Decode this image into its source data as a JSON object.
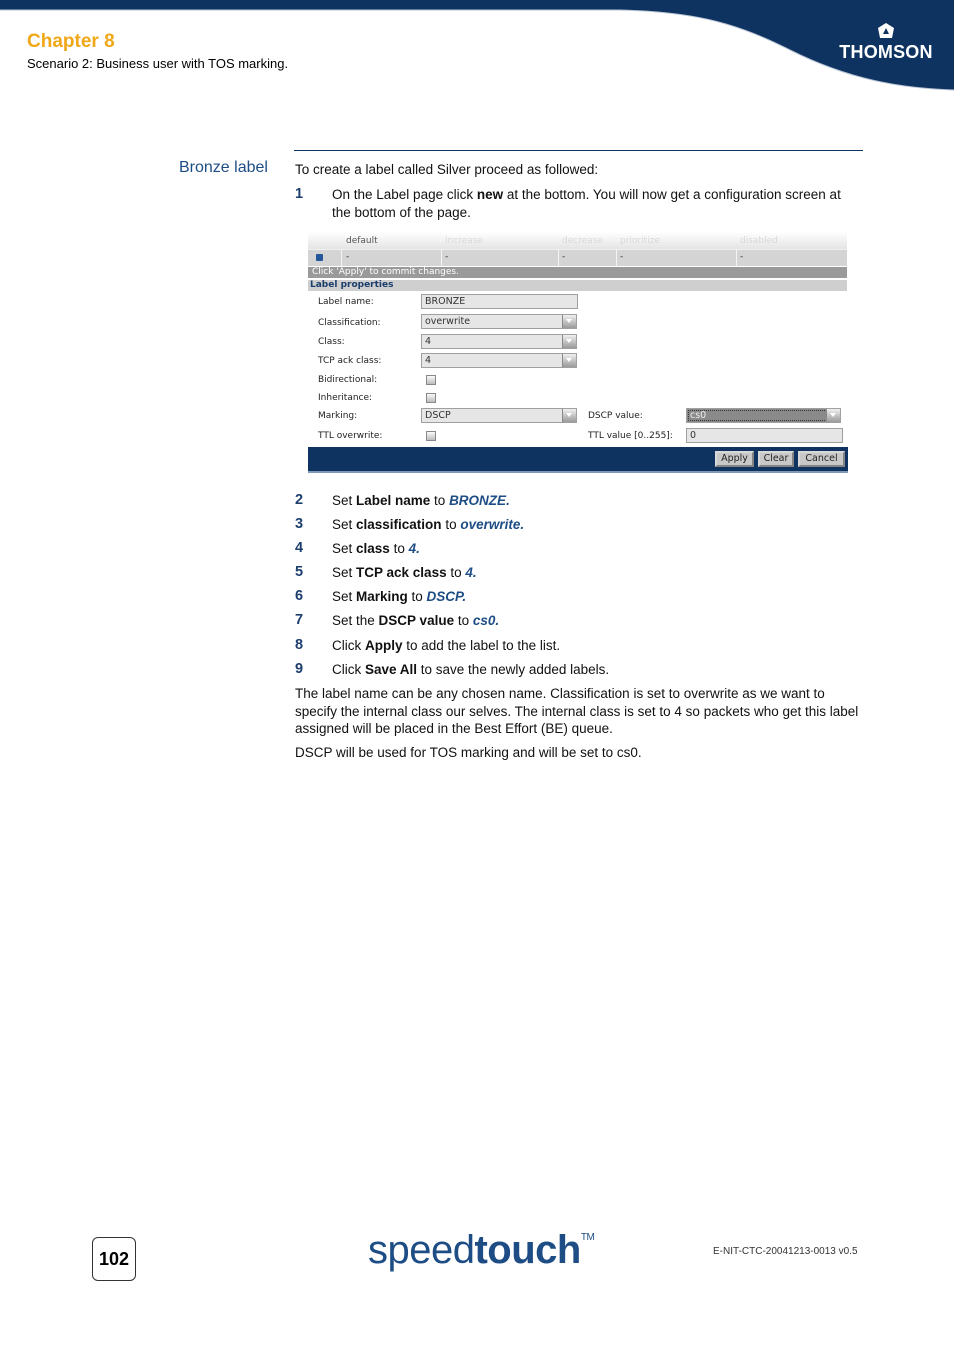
{
  "header": {
    "chapter": "Chapter 8",
    "subtitle": "Scenario 2: Business user with TOS marking.",
    "brand": "THOMSON",
    "brand_icon": "thomson-triangle-icon",
    "colors": {
      "band": "#0e3360",
      "chapter": "#f0a818",
      "accent": "#1d4d84"
    }
  },
  "section": {
    "heading": "Bronze label",
    "intro": "To create a label called Silver proceed as followed:"
  },
  "step1": {
    "num": "1",
    "pre": "On the Label page click ",
    "bold": "new",
    "post": " at the bottom. You will now get a configuration screen at the bottom of the page."
  },
  "screenshot": {
    "table_headers": [
      "default",
      "increase",
      "decrease",
      "prioritize",
      "disabled"
    ],
    "table_row": [
      "-",
      "-",
      "-",
      "-",
      "-"
    ],
    "row_icon": "blue-square-icon",
    "commit_msg": "Click 'Apply' to commit changes.",
    "props_title": "Label properties",
    "fields": {
      "label_name": {
        "label": "Label name:",
        "value": "BRONZE"
      },
      "classification": {
        "label": "Classification:",
        "value": "overwrite"
      },
      "class": {
        "label": "Class:",
        "value": "4"
      },
      "tcp_ack_class": {
        "label": "TCP ack class:",
        "value": "4"
      },
      "bidirectional": {
        "label": "Bidirectional:",
        "checked": false
      },
      "inheritance": {
        "label": "Inheritance:",
        "checked": false
      },
      "marking": {
        "label": "Marking:",
        "value": "DSCP"
      },
      "dscp_value": {
        "label": "DSCP value:",
        "value": "cs0"
      },
      "ttl_overwrite": {
        "label": "TTL overwrite:",
        "checked": false
      },
      "ttl_value": {
        "label": "TTL value [0..255]:",
        "value": "0"
      }
    },
    "buttons": {
      "apply": "Apply",
      "clear": "Clear",
      "cancel": "Cancel"
    }
  },
  "steps": [
    {
      "num": "2",
      "pre": "Set ",
      "bold": "Label name",
      "mid": " to ",
      "val": "BRONZE",
      "post": "."
    },
    {
      "num": "3",
      "pre": "Set ",
      "bold": "classification",
      "mid": " to ",
      "val": "overwrite",
      "post": "."
    },
    {
      "num": "4",
      "pre": "Set ",
      "bold": "class",
      "mid": " to ",
      "val": "4",
      "post": "."
    },
    {
      "num": "5",
      "pre": "Set ",
      "bold": "TCP ack class",
      "mid": " to ",
      "val": "4",
      "post": "."
    },
    {
      "num": "6",
      "pre": "Set ",
      "bold": "Marking",
      "mid": " to ",
      "val": "DSCP",
      "post": "."
    },
    {
      "num": "7",
      "pre": "Set the ",
      "bold": "DSCP value",
      "mid": " to ",
      "val": "cs0",
      "post": "."
    },
    {
      "num": "8",
      "pre": "Click ",
      "bold": "Apply",
      "mid": " to add the label to the list.",
      "val": "",
      "post": ""
    },
    {
      "num": "9",
      "pre": "Click ",
      "bold": "Save All",
      "mid": " to save the newly added labels.",
      "val": "",
      "post": ""
    }
  ],
  "paragraphs": [
    "The label name can be any chosen name. Classification is set to overwrite as we want to specify the internal class our selves. The internal class is set to 4 so packets who get this label assigned will be placed in the Best Effort (BE) queue.",
    "DSCP will be used for TOS marking and will be set to cs0."
  ],
  "footer": {
    "page": "102",
    "brand_light": "speed",
    "brand_bold": "touch",
    "brand_tm": "TM",
    "doc_id": "E-NIT-CTC-20041213-0013 v0.5"
  }
}
